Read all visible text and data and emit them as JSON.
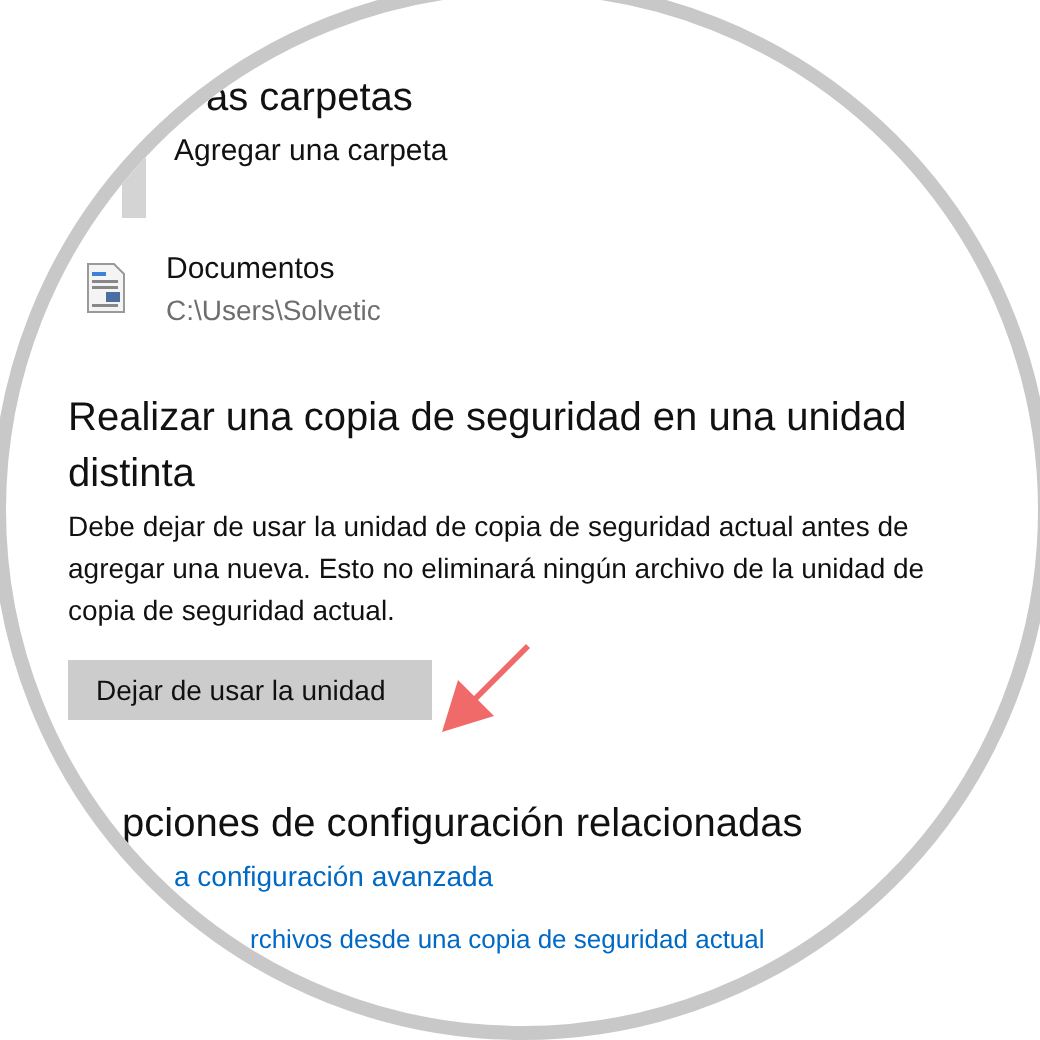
{
  "folders_section": {
    "heading": "as carpetas",
    "add_label": "Agregar una carpeta",
    "folders": [
      {
        "name": "Documentos",
        "path": "C:\\Users\\Solvetic"
      }
    ]
  },
  "backup_section": {
    "heading": "Realizar una copia de seguridad en una unidad distinta",
    "description": "Debe dejar de usar la unidad de copia de seguridad actual antes de agregar una nueva. Esto no eliminará ningún archivo de la unidad de copia de seguridad actual.",
    "button": "Dejar de usar la unidad"
  },
  "related_section": {
    "heading": "pciones de configuración relacionadas",
    "links": [
      "a configuración avanzada",
      "rchivos desde una copia de seguridad actual"
    ]
  }
}
